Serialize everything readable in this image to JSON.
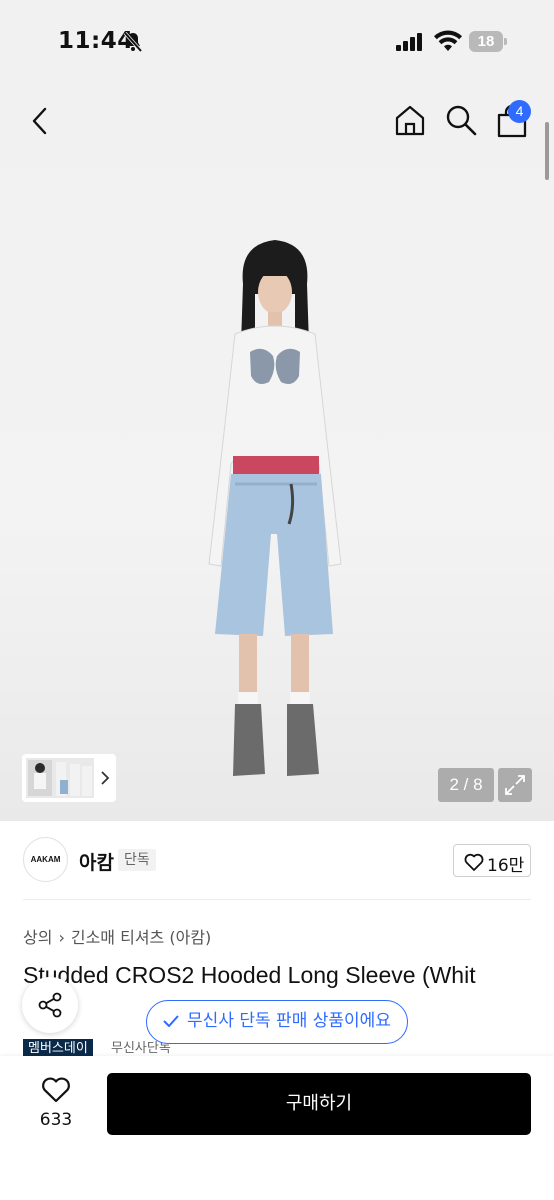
{
  "status_bar": {
    "time": "11:44",
    "battery": "18"
  },
  "nav": {
    "cart_badge": "4"
  },
  "gallery": {
    "page_indicator": "2 / 8"
  },
  "brand": {
    "logo_text": "AAKAM",
    "name": "아캄",
    "tag": "단독",
    "likes": "16만"
  },
  "breadcrumb": {
    "category": "상의",
    "subcategory": "긴소매 티셔츠 (아캄)"
  },
  "product": {
    "title": "Studded CROS2 Hooded Long Sleeve (Whit"
  },
  "toast": {
    "text": "무신사 단독 판매 상품이에요"
  },
  "badges": {
    "member": "멤버스데이",
    "exclusive": "무신사단독"
  },
  "bottom_bar": {
    "wish_count": "633",
    "buy_label": "구매하기"
  },
  "colors": {
    "accent": "#2f6bff",
    "badge_bg": "#0b2a4a",
    "buy_bg": "#000000"
  }
}
